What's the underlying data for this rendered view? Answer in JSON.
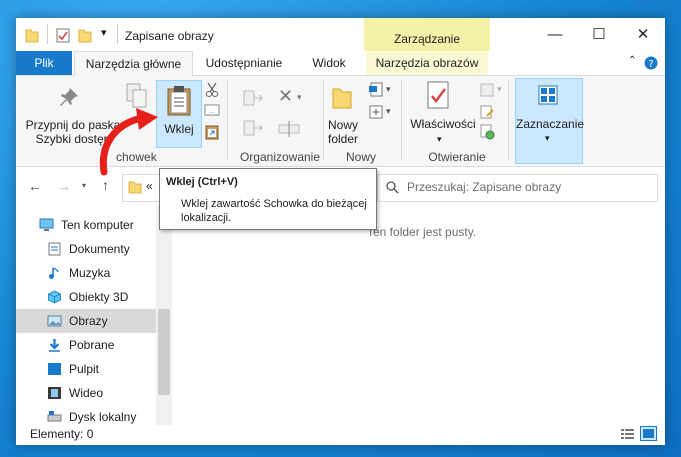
{
  "window": {
    "title": "Zapisane obrazy",
    "contextual_header": "Zarządzanie",
    "controls": {
      "minimize": "—",
      "maximize": "☐",
      "close": "✕"
    }
  },
  "tabs": {
    "file": "Plik",
    "home": "Narzędzia główne",
    "share": "Udostępnianie",
    "view": "Widok",
    "picture_tools": "Narzędzia obrazów"
  },
  "ribbon": {
    "pin": [
      "Przypnij do paska",
      "Szybki dostęp"
    ],
    "paste": "Wklej",
    "group_clipboard": "chowek",
    "group_organize": "Organizowanie",
    "new_folder": [
      "Nowy",
      "folder"
    ],
    "group_new": "Nowy",
    "properties": "Właściwości",
    "group_open": "Otwieranie",
    "select": "Zaznaczanie"
  },
  "nav": {
    "address_overflow": "«",
    "search_placeholder": "Przeszukaj: Zapisane obrazy"
  },
  "sidebar": {
    "items": [
      {
        "label": "Ten komputer",
        "icon": "computer-icon"
      },
      {
        "label": "Dokumenty",
        "icon": "documents-icon"
      },
      {
        "label": "Muzyka",
        "icon": "music-icon"
      },
      {
        "label": "Obiekty 3D",
        "icon": "objects-3d-icon"
      },
      {
        "label": "Obrazy",
        "icon": "pictures-icon"
      },
      {
        "label": "Pobrane",
        "icon": "downloads-icon"
      },
      {
        "label": "Pulpit",
        "icon": "desktop-icon"
      },
      {
        "label": "Wideo",
        "icon": "video-icon"
      },
      {
        "label": "Dysk lokalny (C:)",
        "icon": "drive-icon"
      }
    ]
  },
  "content": {
    "empty_text": "Ten folder jest pusty."
  },
  "status": {
    "items": "Elementy: 0"
  },
  "tooltip": {
    "title": "Wklej (Ctrl+V)",
    "body": "Wklej zawartość Schowka do bieżącej lokalizacji."
  },
  "colors": {
    "accent": "#1979ca",
    "arrow": "#e8201c",
    "context_tab": "#f6f1a8"
  }
}
